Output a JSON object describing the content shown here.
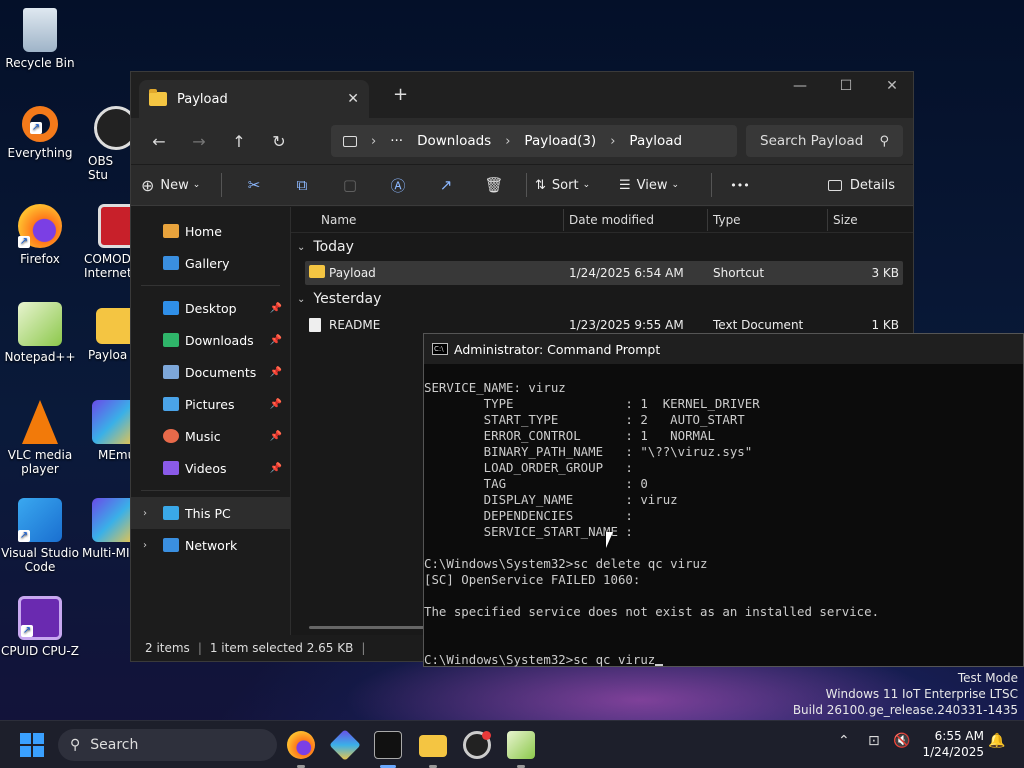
{
  "desktop": {
    "icons": [
      {
        "label": "Recycle Bin"
      },
      {
        "label": "Everything"
      },
      {
        "label": "OBS Stu"
      },
      {
        "label": "Firefox"
      },
      {
        "label": "COMOD Internet S"
      },
      {
        "label": "Notepad++"
      },
      {
        "label": "Payloa"
      },
      {
        "label": "VLC media player"
      },
      {
        "label": "MEmu"
      },
      {
        "label": "Visual Studio Code"
      },
      {
        "label": "Multi-MI"
      },
      {
        "label": "CPUID CPU-Z"
      }
    ]
  },
  "explorer": {
    "tab_title": "Payload",
    "tab_close": "✕",
    "tab_add": "+",
    "window_controls": {
      "minimize": "—",
      "maximize": "☐",
      "close": "✕"
    },
    "nav": {
      "back": "←",
      "forward": "→",
      "up": "↑",
      "refresh": "↻"
    },
    "breadcrumb": {
      "more": "···",
      "items": [
        "Downloads",
        "Payload(3)",
        "Payload"
      ]
    },
    "search_placeholder": "Search Payload",
    "toolbar": {
      "new": "New",
      "sort": "Sort",
      "view": "View",
      "more": "•••",
      "details": "Details"
    },
    "sidebar": {
      "top": [
        {
          "label": "Home",
          "color": "#e8a33c"
        },
        {
          "label": "Gallery",
          "color": "#3a8fe0"
        }
      ],
      "pinned": [
        {
          "label": "Desktop",
          "color": "#2f8fe8"
        },
        {
          "label": "Downloads",
          "color": "#2fb56a"
        },
        {
          "label": "Documents",
          "color": "#7da7d9"
        },
        {
          "label": "Pictures",
          "color": "#4aa3e8"
        },
        {
          "label": "Music",
          "color": "#e86a4a"
        },
        {
          "label": "Videos",
          "color": "#8a5ae8"
        }
      ],
      "bottom": [
        {
          "label": "This PC",
          "color": "#3aa8e8"
        },
        {
          "label": "Network",
          "color": "#3a8fe0"
        }
      ]
    },
    "columns": {
      "name": "Name",
      "date": "Date modified",
      "type": "Type",
      "size": "Size"
    },
    "groups": [
      {
        "label": "Today",
        "files": [
          {
            "name": "Payload",
            "date": "1/24/2025 6:54 AM",
            "type": "Shortcut",
            "size": "3 KB"
          }
        ]
      },
      {
        "label": "Yesterday",
        "files": [
          {
            "name": "README",
            "date": "1/23/2025 9:55 AM",
            "type": "Text Document",
            "size": "1 KB"
          }
        ]
      }
    ],
    "status": {
      "items": "2 items",
      "selected": "1 item selected  2.65 KB"
    }
  },
  "cmd": {
    "title": "Administrator: Command Prompt",
    "lines": [
      "SERVICE_NAME: viruz",
      "        TYPE               : 1  KERNEL_DRIVER",
      "        START_TYPE         : 2   AUTO_START",
      "        ERROR_CONTROL      : 1   NORMAL",
      "        BINARY_PATH_NAME   : \"\\??\\viruz.sys\"",
      "        LOAD_ORDER_GROUP   :",
      "        TAG                : 0",
      "        DISPLAY_NAME       : viruz",
      "        DEPENDENCIES       :",
      "        SERVICE_START_NAME :",
      "",
      "C:\\Windows\\System32>sc delete qc viruz",
      "[SC] OpenService FAILED 1060:",
      "",
      "The specified service does not exist as an installed service.",
      "",
      ""
    ],
    "prompt": "C:\\Windows\\System32>sc qc viruz"
  },
  "watermark": {
    "line1": "Test Mode",
    "line2": "Windows 11 IoT Enterprise LTSC",
    "line3": "Build 26100.ge_release.240331-1435"
  },
  "taskbar": {
    "search_label": "Search",
    "time": "6:55 AM",
    "date": "1/24/2025"
  }
}
